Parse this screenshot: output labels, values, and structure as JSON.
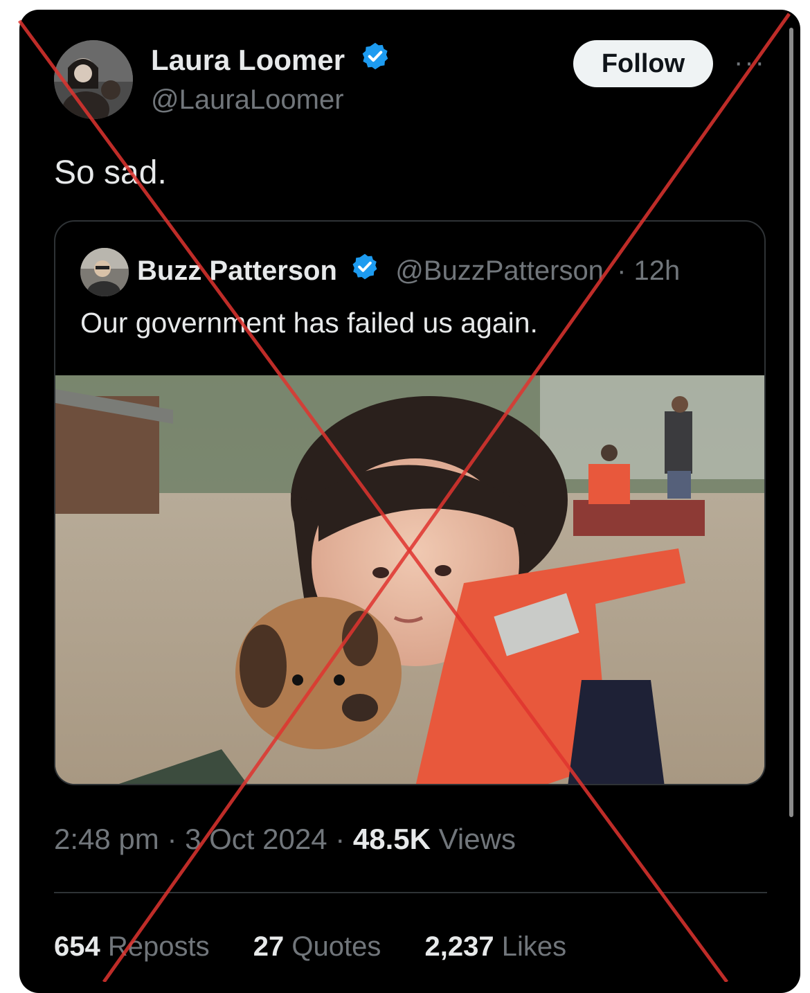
{
  "tweet": {
    "author_name": "Laura Loomer",
    "author_handle": "@LauraLoomer",
    "follow_label": "Follow",
    "more_label": "···",
    "text": "So sad.",
    "time": "2:48 pm",
    "date": "3 Oct 2024",
    "sep": "·",
    "views_count": "48.5K",
    "views_label": "Views",
    "stats": [
      {
        "count": "654",
        "label": "Reposts"
      },
      {
        "count": "27",
        "label": "Quotes"
      },
      {
        "count": "2,237",
        "label": "Likes"
      }
    ]
  },
  "quoted": {
    "author_name": "Buzz Patterson",
    "author_handle": "@BuzzPatterson",
    "age": "· 12h",
    "text": "Our government has failed us again."
  },
  "colors": {
    "background": "#000000",
    "text_primary": "#e7e9ea",
    "text_secondary": "#71767b",
    "verified": "#1d9bf0",
    "cross_overlay": "#e0342f",
    "life_vest": "#e8583c"
  },
  "icons": [
    "verified-badge-icon",
    "more-options-icon"
  ]
}
